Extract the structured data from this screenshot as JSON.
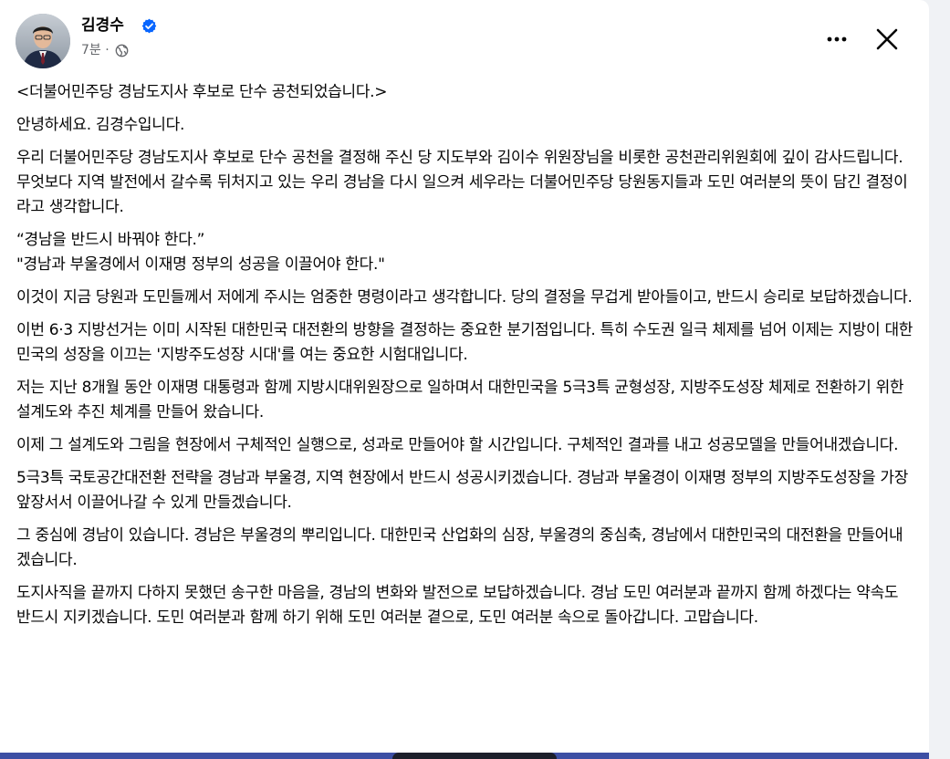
{
  "post": {
    "author": "김경수",
    "time": "7분",
    "separator": "·"
  },
  "icons": {
    "verified": "verified-badge-icon",
    "audience": "globe-icon",
    "more": "more-horizontal-icon",
    "close": "close-icon"
  },
  "colors": {
    "verified": "#0866ff",
    "text": "#050505",
    "secondary": "#65676b",
    "image_band": "#3d4fa4"
  },
  "body": {
    "title": "<더불어민주당 경남도지사 후보로 단수 공천되었습니다.>",
    "greeting": "안녕하세요. 김경수입니다.",
    "p1": "우리 더불어민주당 경남도지사 후보로 단수 공천을 결정해 주신 당 지도부와 김이수 위원장님을 비롯한 공천관리위원회에 깊이 감사드립니다. 무엇보다 지역 발전에서 갈수록 뒤처지고 있는 우리 경남을 다시 일으켜 세우라는 더불어민주당 당원동지들과 도민 여러분의 뜻이 담긴 결정이라고 생각합니다.",
    "quote1": " “경남을 반드시 바꿔야 한다.”",
    "quote2": " \"경남과 부울경에서 이재명 정부의 성공을 이끌어야 한다.\"",
    "p2": "이것이 지금 당원과 도민들께서 저에게 주시는 엄중한 명령이라고 생각합니다. 당의 결정을 무겁게 받아들이고, 반드시 승리로 보답하겠습니다.",
    "p3": "이번 6·3 지방선거는 이미 시작된 대한민국 대전환의 방향을 결정하는 중요한 분기점입니다. 특히 수도권 일극 체제를 넘어 이제는 지방이 대한민국의 성장을 이끄는 '지방주도성장 시대'를 여는 중요한 시험대입니다.",
    "p4": "저는 지난 8개월 동안 이재명 대통령과 함께 지방시대위원장으로 일하며서 대한민국을 5극3특 균형성장, 지방주도성장 체제로 전환하기 위한 설계도와 추진 체계를 만들어 왔습니다.",
    "p5": "이제 그 설계도와 그림을 현장에서 구체적인 실행으로, 성과로 만들어야 할 시간입니다. 구체적인 결과를 내고 성공모델을 만들어내겠습니다.",
    "p6": "5극3특 국토공간대전환 전략을 경남과 부울경, 지역 현장에서 반드시 성공시키겠습니다. 경남과 부울경이 이재명 정부의 지방주도성장을 가장 앞장서서 이끌어나갈 수 있게 만들겠습니다.",
    "p7": "그 중심에 경남이 있습니다. 경남은 부울경의 뿌리입니다. 대한민국 산업화의 심장, 부울경의 중심축, 경남에서 대한민국의 대전환을 만들어내겠습니다.",
    "p8": "도지사직을 끝까지 다하지 못했던 송구한 마음을, 경남의 변화와 발전으로 보답하겠습니다. 경남 도민 여러분과 끝까지 함께 하겠다는 약속도 반드시 지키겠습니다. 도민 여러분과 함께 하기 위해 도민 여러분 곁으로, 도민 여러분 속으로 돌아갑니다. 고맙습니다."
  }
}
